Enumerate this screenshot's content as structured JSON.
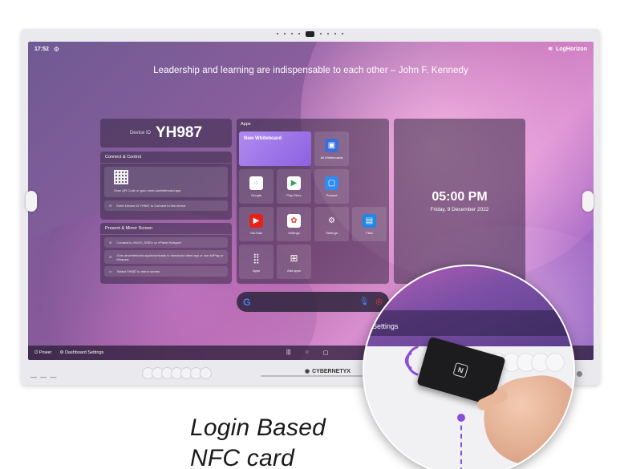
{
  "status_bar": {
    "time": "17:52",
    "network_name": "LogHorizon"
  },
  "quote": "Leadership and learning are indispensable to each other – John F. Kennedy",
  "device": {
    "label": "Device ID",
    "value": "YH987"
  },
  "connect": {
    "title": "Connect & Control",
    "qr_text": "Scan QR Code or goto meet.airwhiteboard.app",
    "enter_text": "Enter Device ID YH987 to Connect to this device"
  },
  "present": {
    "title": "Present & Mirror Screen",
    "wifi_text": "Connect to «Wi-Fi_SSID» or «Panel Hotspot»",
    "app_text": "Goto airwhiteboard.app/downloads to download client app or use AirPlay or Miracast",
    "select_text": "Select YH987 to mirror screen"
  },
  "apps": {
    "title": "Apps",
    "new_whiteboard": "New Whiteboard",
    "tiles": [
      {
        "label": "All Whiteboards",
        "icon": "whiteboard-icon"
      },
      {
        "label": "Google",
        "icon": "google-apps-icon"
      },
      {
        "label": "Play Store",
        "icon": "play-store-icon"
      },
      {
        "label": "Present",
        "icon": "cast-icon"
      },
      {
        "label": "YouTube",
        "icon": "youtube-icon"
      },
      {
        "label": "Settings",
        "icon": "photos-icon"
      },
      {
        "label": "Settings",
        "icon": "gear-icon"
      },
      {
        "label": "Files",
        "icon": "files-icon"
      },
      {
        "label": "Apps",
        "icon": "grid-icon"
      },
      {
        "label": "Add apps",
        "icon": "add-apps-icon"
      }
    ]
  },
  "clock": {
    "time": "05:00 PM",
    "date": "Friday, 9 December 2022"
  },
  "bottom_bar": {
    "power": "Power",
    "dashboard": "Dashboard Settings"
  },
  "brand": "CYBERNETYX",
  "zoom": {
    "settings": "Settings"
  },
  "caption": {
    "line1": "Login Based",
    "line2": "NFC card"
  },
  "colors": {
    "accent": "#8a4fd8",
    "google_blue": "#4285f4"
  }
}
